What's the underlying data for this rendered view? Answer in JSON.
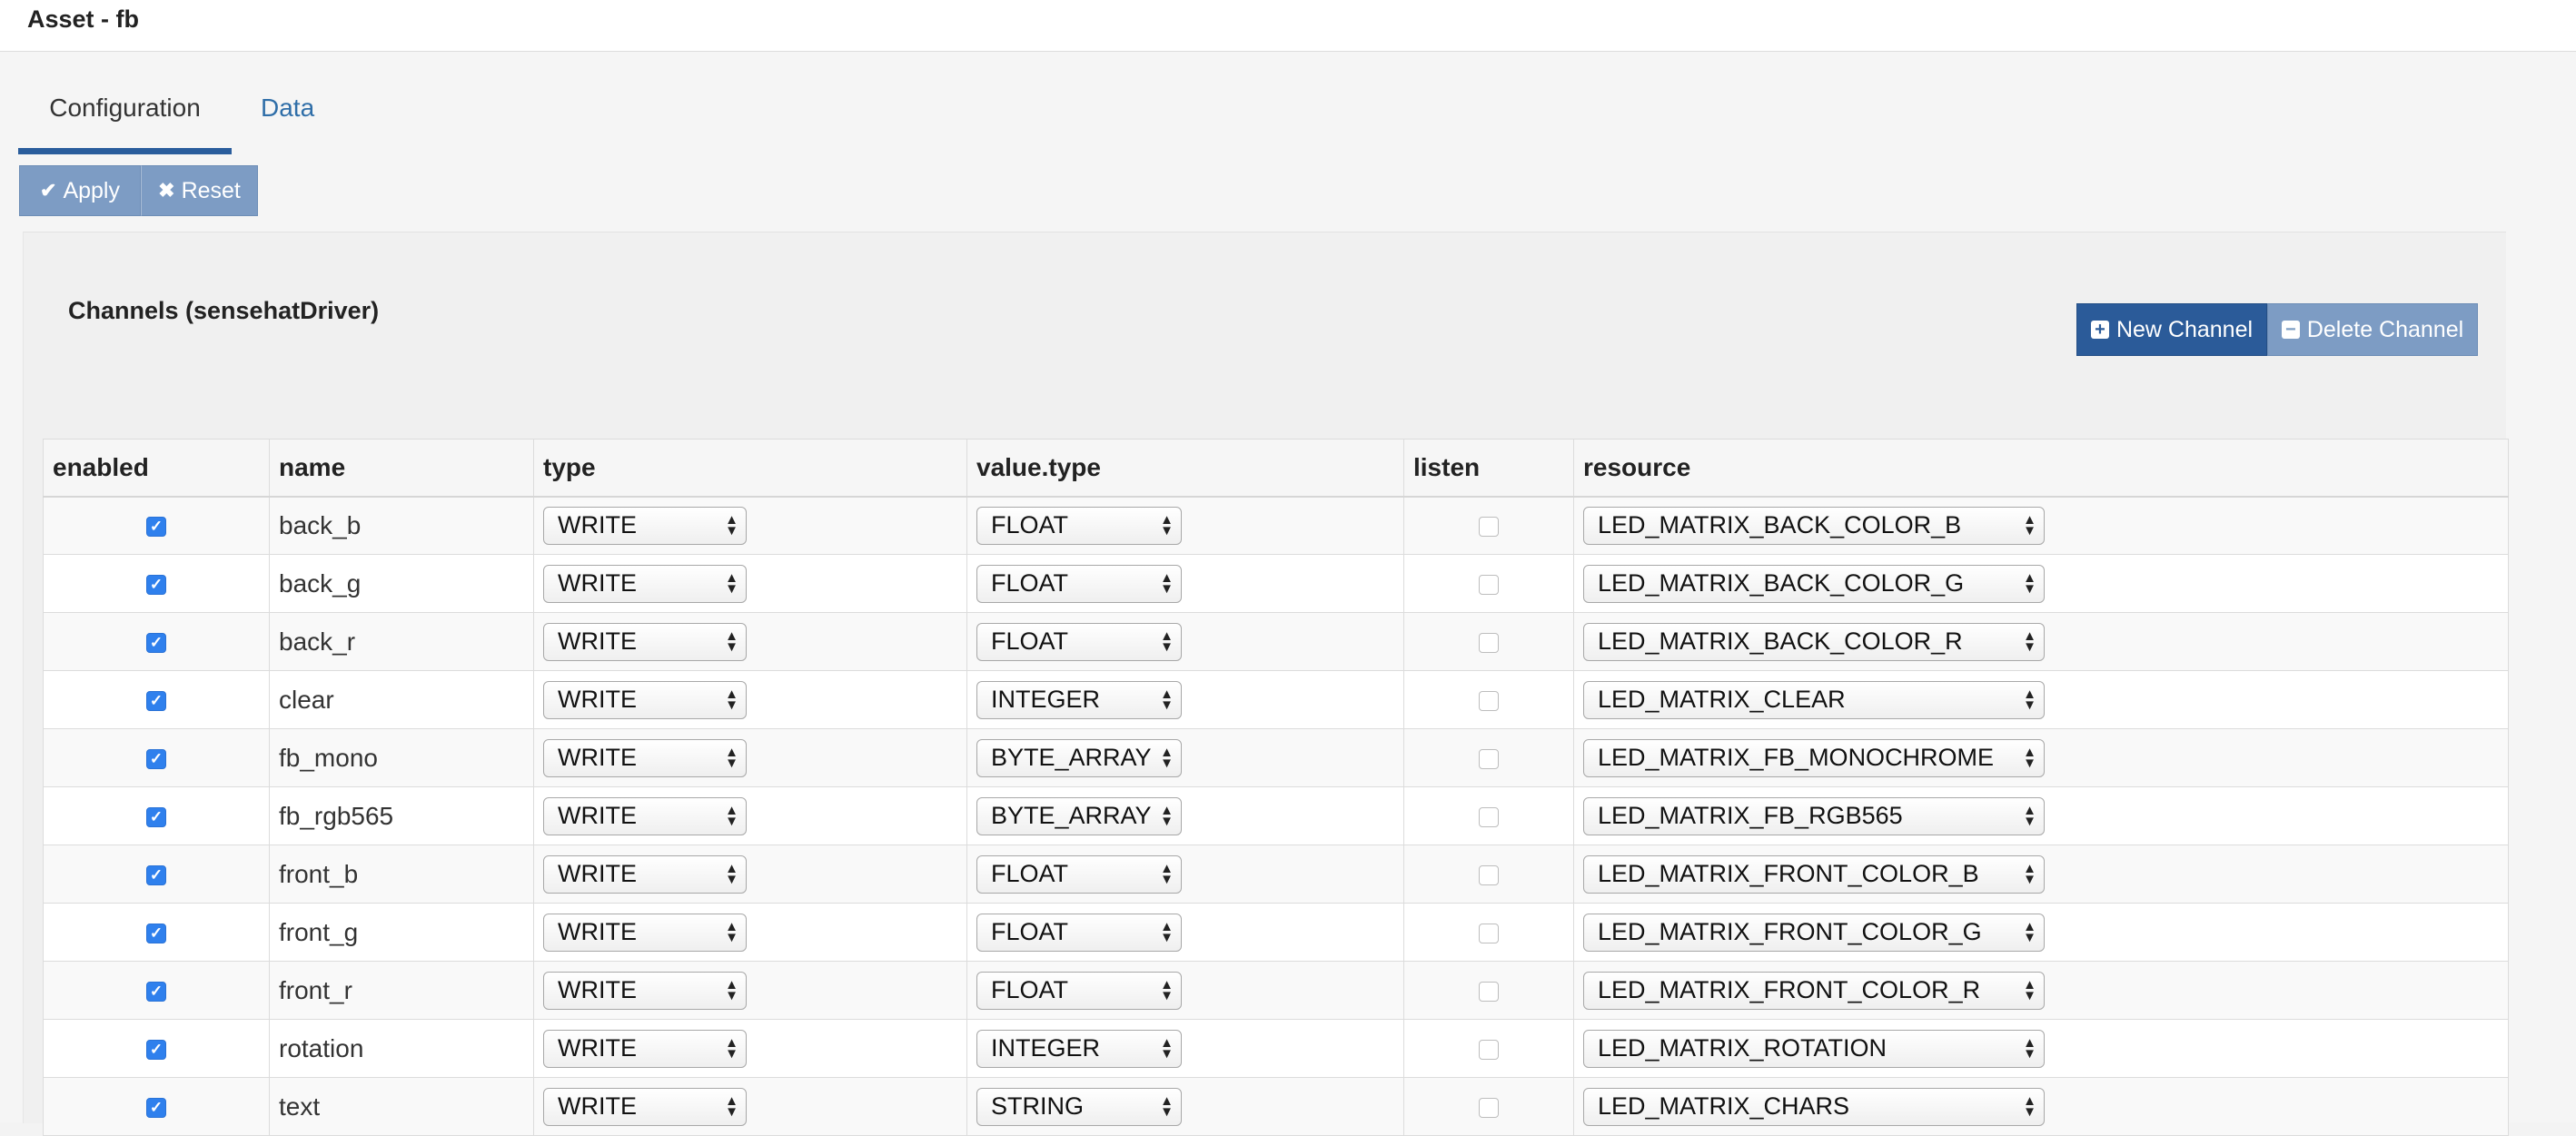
{
  "header": {
    "title": "Asset - fb"
  },
  "tabs": [
    {
      "label": "Configuration"
    },
    {
      "label": "Data"
    }
  ],
  "toolbar": {
    "apply_label": "Apply",
    "reset_label": "Reset"
  },
  "panel": {
    "title": "Channels (sensehatDriver)",
    "new_channel_label": "New Channel",
    "delete_channel_label": "Delete Channel"
  },
  "table": {
    "headers": {
      "enabled": "enabled",
      "name": "name",
      "type": "type",
      "value_type": "value.type",
      "listen": "listen",
      "resource": "resource"
    },
    "rows": [
      {
        "enabled": true,
        "name": "back_b",
        "type": "WRITE",
        "value_type": "FLOAT",
        "listen": false,
        "resource": "LED_MATRIX_BACK_COLOR_B"
      },
      {
        "enabled": true,
        "name": "back_g",
        "type": "WRITE",
        "value_type": "FLOAT",
        "listen": false,
        "resource": "LED_MATRIX_BACK_COLOR_G"
      },
      {
        "enabled": true,
        "name": "back_r",
        "type": "WRITE",
        "value_type": "FLOAT",
        "listen": false,
        "resource": "LED_MATRIX_BACK_COLOR_R"
      },
      {
        "enabled": true,
        "name": "clear",
        "type": "WRITE",
        "value_type": "INTEGER",
        "listen": false,
        "resource": "LED_MATRIX_CLEAR"
      },
      {
        "enabled": true,
        "name": "fb_mono",
        "type": "WRITE",
        "value_type": "BYTE_ARRAY",
        "listen": false,
        "resource": "LED_MATRIX_FB_MONOCHROME"
      },
      {
        "enabled": true,
        "name": "fb_rgb565",
        "type": "WRITE",
        "value_type": "BYTE_ARRAY",
        "listen": false,
        "resource": "LED_MATRIX_FB_RGB565"
      },
      {
        "enabled": true,
        "name": "front_b",
        "type": "WRITE",
        "value_type": "FLOAT",
        "listen": false,
        "resource": "LED_MATRIX_FRONT_COLOR_B"
      },
      {
        "enabled": true,
        "name": "front_g",
        "type": "WRITE",
        "value_type": "FLOAT",
        "listen": false,
        "resource": "LED_MATRIX_FRONT_COLOR_G"
      },
      {
        "enabled": true,
        "name": "front_r",
        "type": "WRITE",
        "value_type": "FLOAT",
        "listen": false,
        "resource": "LED_MATRIX_FRONT_COLOR_R"
      },
      {
        "enabled": true,
        "name": "rotation",
        "type": "WRITE",
        "value_type": "INTEGER",
        "listen": false,
        "resource": "LED_MATRIX_ROTATION"
      },
      {
        "enabled": true,
        "name": "text",
        "type": "WRITE",
        "value_type": "STRING",
        "listen": false,
        "resource": "LED_MATRIX_CHARS"
      }
    ]
  },
  "colors": {
    "primary": "#2b5b99",
    "secondary": "#7d9cc4",
    "link": "#2f6ea8",
    "checkbox_checked": "#2f80ed"
  },
  "icons": {
    "apply": "check-icon",
    "reset": "x-icon",
    "new_channel": "plus-square-icon",
    "delete_channel": "minus-square-icon",
    "select": "updown-arrows-icon"
  }
}
